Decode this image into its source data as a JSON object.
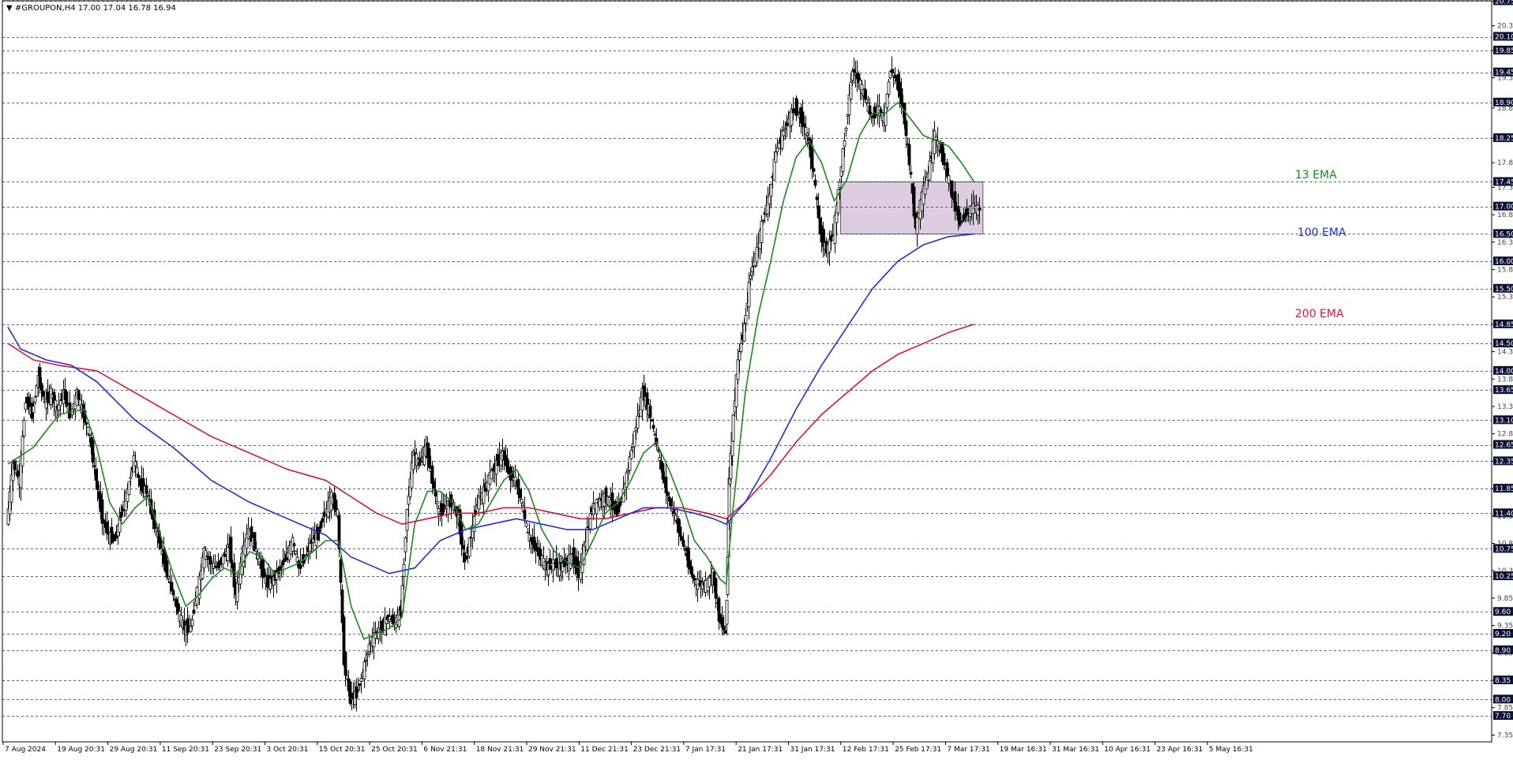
{
  "chart_data": {
    "type": "candlestick",
    "title": "▼ #GROUPON,H4  17.00 17.04 16.78 16.94",
    "symbol": "#GROUPON",
    "timeframe": "H4",
    "ohlc_last": {
      "open": 17.0,
      "high": 17.04,
      "low": 16.78,
      "close": 16.94
    },
    "ylim": [
      7.2,
      20.9
    ],
    "grid": "horizontal dashed at highlighted levels",
    "price_ticks": [
      20.75,
      20.3,
      19.85,
      19.35,
      18.8,
      18.25,
      17.8,
      17.35,
      16.85,
      16.35,
      15.85,
      15.35,
      14.85,
      14.35,
      13.85,
      13.35,
      12.85,
      12.35,
      11.85,
      11.35,
      10.85,
      10.35,
      9.85,
      9.35,
      8.85,
      8.35,
      7.85,
      7.35
    ],
    "highlight_levels": [
      20.75,
      20.1,
      19.85,
      19.45,
      18.9,
      18.25,
      17.45,
      17.0,
      16.5,
      16.0,
      15.5,
      14.85,
      14.5,
      14.0,
      13.65,
      13.1,
      12.65,
      12.35,
      11.85,
      11.4,
      10.75,
      10.25,
      9.6,
      9.2,
      8.9,
      8.35,
      8.0,
      7.7
    ],
    "time_labels": [
      "7 Aug 2024",
      "19 Aug 20:31",
      "29 Aug 20:31",
      "11 Sep 20:31",
      "23 Sep 20:31",
      "3 Oct 20:31",
      "15 Oct 20:31",
      "25 Oct 20:31",
      "6 Nov 21:31",
      "18 Nov 21:31",
      "29 Nov 21:31",
      "11 Dec 21:31",
      "23 Dec 21:31",
      "7 Jan 17:31",
      "21 Jan 17:31",
      "31 Jan 17:31",
      "12 Feb 17:31",
      "25 Feb 17:31",
      "7 Mar 17:31",
      "19 Mar 16:31",
      "31 Mar 16:31",
      "10 Apr 16:31",
      "23 Apr 16:31",
      "5 May 16:31"
    ],
    "zone": {
      "low": 16.5,
      "high": 17.45,
      "color": "#d8c4dc"
    },
    "series": [
      {
        "name": "13 EMA",
        "color": "#1a8a1a"
      },
      {
        "name": "100 EMA",
        "color": "#1f2fd0"
      },
      {
        "name": "200 EMA",
        "color": "#d8143a"
      }
    ],
    "price_path": [
      [
        0,
        11.2
      ],
      [
        0.5,
        12.3
      ],
      [
        1,
        12.0
      ],
      [
        1.5,
        13.5
      ],
      [
        2,
        13.2
      ],
      [
        2.5,
        13.9
      ],
      [
        3,
        13.4
      ],
      [
        3.5,
        13.6
      ],
      [
        4,
        13.3
      ],
      [
        4.5,
        13.6
      ],
      [
        5,
        13.2
      ],
      [
        5.5,
        13.6
      ],
      [
        6,
        13.2
      ],
      [
        6.5,
        12.8
      ],
      [
        7,
        12.0
      ],
      [
        7.5,
        11.3
      ],
      [
        8,
        11.0
      ],
      [
        8.5,
        10.9
      ],
      [
        9,
        11.4
      ],
      [
        9.5,
        11.8
      ],
      [
        10,
        12.4
      ],
      [
        10.5,
        11.9
      ],
      [
        11,
        11.8
      ],
      [
        11.5,
        11.3
      ],
      [
        12,
        10.9
      ],
      [
        12.5,
        10.4
      ],
      [
        13,
        10.0
      ],
      [
        13.5,
        9.6
      ],
      [
        14,
        9.3
      ],
      [
        14.5,
        9.3
      ],
      [
        15,
        10.0
      ],
      [
        15.5,
        10.7
      ],
      [
        16,
        10.5
      ],
      [
        16.5,
        10.4
      ],
      [
        17,
        10.6
      ],
      [
        17.5,
        10.8
      ],
      [
        18,
        9.9
      ],
      [
        18.5,
        10.6
      ],
      [
        19,
        11.1
      ],
      [
        19.5,
        10.8
      ],
      [
        20,
        10.4
      ],
      [
        20.5,
        10.1
      ],
      [
        21,
        10.2
      ],
      [
        21.5,
        10.4
      ],
      [
        22,
        10.6
      ],
      [
        22.5,
        10.9
      ],
      [
        23,
        10.4
      ],
      [
        23.5,
        10.6
      ],
      [
        24,
        10.9
      ],
      [
        24.5,
        11.0
      ],
      [
        25,
        11.4
      ],
      [
        25.5,
        11.7
      ],
      [
        26,
        11.4
      ],
      [
        26.5,
        8.7
      ],
      [
        27,
        8.0
      ],
      [
        27.5,
        8.1
      ],
      [
        28,
        8.5
      ],
      [
        28.5,
        9.0
      ],
      [
        29,
        9.2
      ],
      [
        29.5,
        9.3
      ],
      [
        30,
        9.5
      ],
      [
        30.5,
        9.4
      ],
      [
        31,
        9.6
      ],
      [
        31.5,
        11.5
      ],
      [
        32,
        12.5
      ],
      [
        32.5,
        12.3
      ],
      [
        33,
        12.6
      ],
      [
        33.5,
        12.0
      ],
      [
        34,
        11.4
      ],
      [
        34.5,
        11.5
      ],
      [
        35,
        11.6
      ],
      [
        35.5,
        11.3
      ],
      [
        36,
        10.5
      ],
      [
        36.5,
        11.0
      ],
      [
        37,
        11.6
      ],
      [
        37.5,
        11.8
      ],
      [
        38,
        12.1
      ],
      [
        38.5,
        12.3
      ],
      [
        39,
        12.5
      ],
      [
        39.5,
        12.1
      ],
      [
        40,
        12.0
      ],
      [
        40.5,
        11.6
      ],
      [
        41,
        11.0
      ],
      [
        41.5,
        10.8
      ],
      [
        42,
        10.6
      ],
      [
        42.5,
        10.4
      ],
      [
        43,
        10.5
      ],
      [
        43.5,
        10.4
      ],
      [
        44,
        10.5
      ],
      [
        44.5,
        10.6
      ],
      [
        45,
        10.3
      ],
      [
        45.5,
        10.9
      ],
      [
        46,
        11.5
      ],
      [
        46.5,
        11.6
      ],
      [
        47,
        11.7
      ],
      [
        47.5,
        11.6
      ],
      [
        48,
        11.4
      ],
      [
        48.5,
        11.8
      ],
      [
        49,
        12.4
      ],
      [
        49.5,
        13.0
      ],
      [
        50,
        13.6
      ],
      [
        50.5,
        13.3
      ],
      [
        51,
        12.8
      ],
      [
        51.5,
        12.2
      ],
      [
        52,
        11.7
      ],
      [
        52.5,
        11.4
      ],
      [
        53,
        11.0
      ],
      [
        53.5,
        10.6
      ],
      [
        54,
        10.2
      ],
      [
        54.5,
        10.1
      ],
      [
        55,
        10.1
      ],
      [
        55.5,
        10.3
      ],
      [
        56,
        9.5
      ],
      [
        56.5,
        9.2
      ],
      [
        56.8,
        12.0
      ],
      [
        57,
        12.8
      ],
      [
        57.5,
        14.2
      ],
      [
        58,
        14.8
      ],
      [
        58.5,
        15.8
      ],
      [
        59,
        16.2
      ],
      [
        59.5,
        16.8
      ],
      [
        60,
        17.2
      ],
      [
        60.5,
        18.0
      ],
      [
        61,
        18.3
      ],
      [
        61.5,
        18.6
      ],
      [
        62,
        18.8
      ],
      [
        62.5,
        18.6
      ],
      [
        63,
        18.3
      ],
      [
        63.5,
        17.6
      ],
      [
        64,
        16.5
      ],
      [
        64.5,
        16.2
      ],
      [
        65,
        16.5
      ],
      [
        65.5,
        17.5
      ],
      [
        66,
        18.5
      ],
      [
        66.5,
        19.5
      ],
      [
        67,
        19.3
      ],
      [
        67.5,
        19.0
      ],
      [
        68,
        18.6
      ],
      [
        68.5,
        18.8
      ],
      [
        69,
        18.6
      ],
      [
        69.5,
        19.5
      ],
      [
        70,
        19.3
      ],
      [
        70.5,
        18.8
      ],
      [
        71,
        17.8
      ],
      [
        71.5,
        16.6
      ],
      [
        72,
        17.2
      ],
      [
        72.5,
        17.6
      ],
      [
        73,
        18.3
      ],
      [
        73.5,
        18.0
      ],
      [
        74,
        17.6
      ],
      [
        74.5,
        17.1
      ],
      [
        75,
        16.7
      ],
      [
        75.5,
        16.9
      ],
      [
        76,
        17.0
      ],
      [
        76.5,
        16.94
      ]
    ],
    "ema13_path": [
      [
        0,
        12.3
      ],
      [
        2,
        12.6
      ],
      [
        4,
        13.2
      ],
      [
        6,
        13.3
      ],
      [
        7,
        12.6
      ],
      [
        8,
        11.6
      ],
      [
        9,
        11.2
      ],
      [
        10,
        11.5
      ],
      [
        11,
        11.7
      ],
      [
        12,
        11.0
      ],
      [
        13,
        10.3
      ],
      [
        14,
        9.7
      ],
      [
        15,
        9.9
      ],
      [
        16,
        10.2
      ],
      [
        17,
        10.4
      ],
      [
        18,
        10.3
      ],
      [
        19,
        10.7
      ],
      [
        20,
        10.6
      ],
      [
        21,
        10.3
      ],
      [
        22,
        10.4
      ],
      [
        23,
        10.5
      ],
      [
        24,
        10.7
      ],
      [
        25,
        10.9
      ],
      [
        26,
        10.9
      ],
      [
        27,
        9.7
      ],
      [
        28,
        9.1
      ],
      [
        29,
        9.2
      ],
      [
        30,
        9.3
      ],
      [
        31,
        9.5
      ],
      [
        32,
        11.2
      ],
      [
        33,
        11.8
      ],
      [
        34,
        11.8
      ],
      [
        35,
        11.6
      ],
      [
        36,
        11.1
      ],
      [
        37,
        11.2
      ],
      [
        38,
        11.6
      ],
      [
        39,
        12.0
      ],
      [
        40,
        12.2
      ],
      [
        41,
        11.8
      ],
      [
        42,
        11.1
      ],
      [
        43,
        10.7
      ],
      [
        44,
        10.5
      ],
      [
        45,
        10.4
      ],
      [
        46,
        10.9
      ],
      [
        47,
        11.4
      ],
      [
        48,
        11.6
      ],
      [
        49,
        12.0
      ],
      [
        50,
        12.5
      ],
      [
        51,
        12.7
      ],
      [
        52,
        12.2
      ],
      [
        53,
        11.6
      ],
      [
        54,
        10.9
      ],
      [
        55,
        10.6
      ],
      [
        56,
        10.2
      ],
      [
        56.5,
        10.1
      ],
      [
        57,
        11.4
      ],
      [
        58,
        13.6
      ],
      [
        59,
        15.0
      ],
      [
        60,
        16.0
      ],
      [
        61,
        17.1
      ],
      [
        62,
        17.9
      ],
      [
        63,
        18.2
      ],
      [
        64,
        17.8
      ],
      [
        65,
        17.1
      ],
      [
        66,
        17.5
      ],
      [
        67,
        18.3
      ],
      [
        68,
        18.7
      ],
      [
        69,
        18.7
      ],
      [
        70,
        18.9
      ],
      [
        71,
        18.6
      ],
      [
        72,
        18.3
      ],
      [
        73,
        18.2
      ],
      [
        74,
        18.1
      ],
      [
        75,
        17.8
      ],
      [
        76,
        17.45
      ]
    ],
    "ema100_path": [
      [
        0,
        14.8
      ],
      [
        1,
        14.4
      ],
      [
        3,
        14.2
      ],
      [
        5,
        14.1
      ],
      [
        7,
        13.8
      ],
      [
        10,
        13.1
      ],
      [
        13,
        12.6
      ],
      [
        16,
        12.0
      ],
      [
        19,
        11.6
      ],
      [
        22,
        11.3
      ],
      [
        25,
        11.0
      ],
      [
        27,
        10.6
      ],
      [
        30,
        10.3
      ],
      [
        32,
        10.4
      ],
      [
        34,
        10.9
      ],
      [
        36,
        11.1
      ],
      [
        38,
        11.2
      ],
      [
        40,
        11.3
      ],
      [
        42,
        11.2
      ],
      [
        44,
        11.1
      ],
      [
        46,
        11.1
      ],
      [
        48,
        11.3
      ],
      [
        50,
        11.5
      ],
      [
        52,
        11.5
      ],
      [
        54,
        11.4
      ],
      [
        55.5,
        11.3
      ],
      [
        56.5,
        11.2
      ],
      [
        58,
        11.6
      ],
      [
        60,
        12.4
      ],
      [
        62,
        13.3
      ],
      [
        64,
        14.1
      ],
      [
        66,
        14.8
      ],
      [
        68,
        15.5
      ],
      [
        70,
        16.0
      ],
      [
        72,
        16.3
      ],
      [
        74,
        16.45
      ],
      [
        76,
        16.5
      ]
    ],
    "ema200_path": [
      [
        0,
        14.5
      ],
      [
        2,
        14.2
      ],
      [
        4,
        14.1
      ],
      [
        7,
        14.0
      ],
      [
        10,
        13.6
      ],
      [
        13,
        13.2
      ],
      [
        16,
        12.8
      ],
      [
        19,
        12.5
      ],
      [
        22,
        12.2
      ],
      [
        25,
        12.0
      ],
      [
        27,
        11.7
      ],
      [
        29,
        11.4
      ],
      [
        31,
        11.2
      ],
      [
        33,
        11.3
      ],
      [
        35,
        11.4
      ],
      [
        37,
        11.4
      ],
      [
        39,
        11.5
      ],
      [
        41,
        11.5
      ],
      [
        43,
        11.4
      ],
      [
        45,
        11.3
      ],
      [
        47,
        11.3
      ],
      [
        49,
        11.4
      ],
      [
        51,
        11.5
      ],
      [
        53,
        11.5
      ],
      [
        55,
        11.4
      ],
      [
        56.5,
        11.3
      ],
      [
        58,
        11.6
      ],
      [
        60,
        12.1
      ],
      [
        62,
        12.7
      ],
      [
        64,
        13.2
      ],
      [
        66,
        13.6
      ],
      [
        68,
        14.0
      ],
      [
        70,
        14.3
      ],
      [
        72,
        14.5
      ],
      [
        74,
        14.7
      ],
      [
        76,
        14.85
      ]
    ]
  }
}
